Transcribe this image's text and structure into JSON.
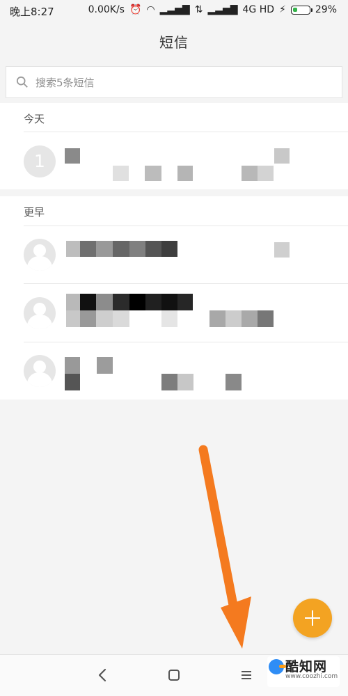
{
  "status": {
    "time": "晚上8:27",
    "network_speed": "0.00K/s",
    "network_type": "4G HD",
    "battery_percent": "29%",
    "battery_level": 0.29,
    "icons": [
      "alarm-off-icon",
      "wifi-icon",
      "signal-icon",
      "data-icon",
      "signal-icon",
      "charging-icon",
      "battery-icon"
    ]
  },
  "header": {
    "title": "短信"
  },
  "search": {
    "icon": "search-icon",
    "placeholder": "搜索5条短信"
  },
  "sections": {
    "today": {
      "label": "今天"
    },
    "earlier": {
      "label": "更早"
    }
  },
  "conversations": [
    {
      "avatar_text": "1",
      "avatar_icon": "",
      "content_state": "pixelated"
    },
    {
      "avatar_text": "",
      "avatar_icon": "person-icon",
      "content_state": "pixelated"
    },
    {
      "avatar_text": "",
      "avatar_icon": "person-icon",
      "content_state": "pixelated"
    },
    {
      "avatar_text": "",
      "avatar_icon": "person-icon",
      "content_state": "pixelated"
    }
  ],
  "fab": {
    "icon": "plus-icon",
    "color": "#f3a322"
  },
  "annotation": {
    "arrow_color": "#f47a1f",
    "icon": "arrow-icon"
  },
  "navigation": {
    "back_icon": "back-icon",
    "home_icon": "home-icon",
    "menu_icon": "menu-icon"
  },
  "watermark": {
    "name": "酷知网",
    "url": "www.coozhi.com",
    "icon": "coozhi-logo-icon"
  },
  "colors": {
    "background": "#f4f4f4",
    "list_background": "#ffffff",
    "accent": "#f3a322",
    "divider": "#e8e8e8"
  }
}
